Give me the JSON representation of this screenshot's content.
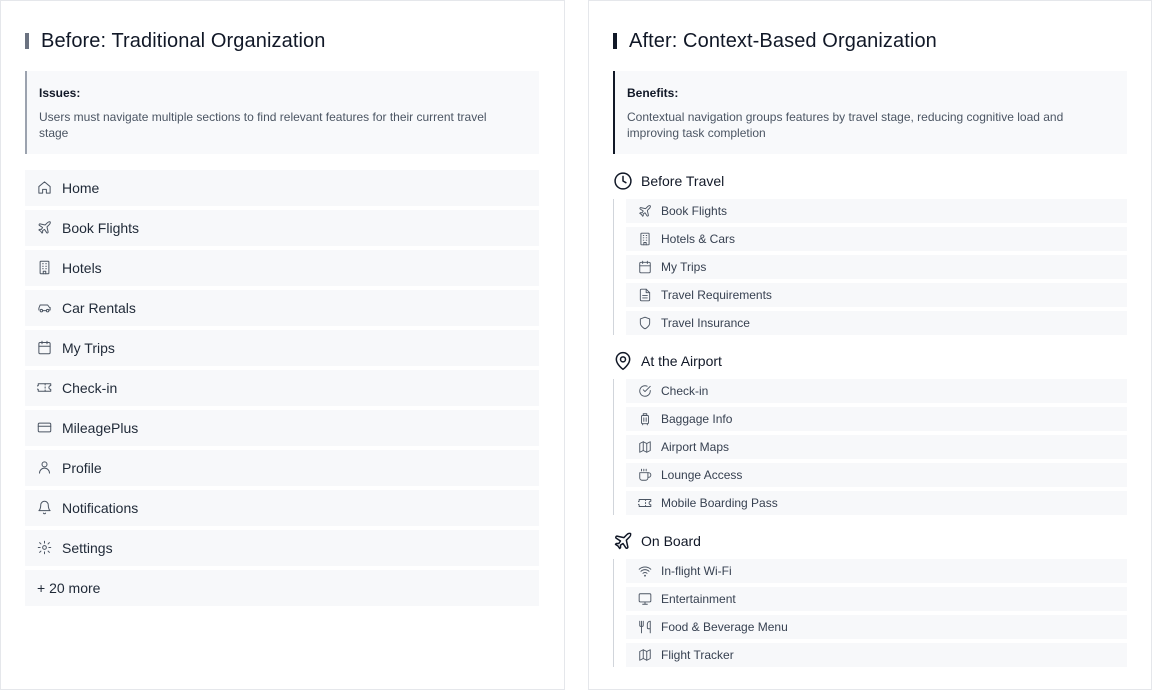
{
  "colors": {
    "accent_bar": "#6b7280",
    "accent_bar_after": "#111827"
  },
  "before": {
    "title": "Before: Traditional Organization",
    "callout": {
      "label": "Issues:",
      "text": "Users must navigate multiple sections to find relevant features for their current travel stage"
    },
    "items": [
      {
        "label": "Home",
        "icon": "home-icon"
      },
      {
        "label": "Book Flights",
        "icon": "plane-icon"
      },
      {
        "label": "Hotels",
        "icon": "building-icon"
      },
      {
        "label": "Car Rentals",
        "icon": "car-icon"
      },
      {
        "label": "My Trips",
        "icon": "calendar-icon"
      },
      {
        "label": "Check-in",
        "icon": "ticket-icon"
      },
      {
        "label": "MileagePlus",
        "icon": "credit-card-icon"
      },
      {
        "label": "Profile",
        "icon": "user-icon"
      },
      {
        "label": "Notifications",
        "icon": "bell-icon"
      },
      {
        "label": "Settings",
        "icon": "gear-icon"
      }
    ],
    "more_label": "+ 20 more"
  },
  "after": {
    "title": "After: Context-Based Organization",
    "callout": {
      "label": "Benefits:",
      "text": "Contextual navigation groups features by travel stage, reducing cognitive load and improving task completion"
    },
    "groups": [
      {
        "label": "Before Travel",
        "icon": "clock-icon",
        "items": [
          {
            "label": "Book Flights",
            "icon": "plane-icon"
          },
          {
            "label": "Hotels & Cars",
            "icon": "building-icon"
          },
          {
            "label": "My Trips",
            "icon": "calendar-icon"
          },
          {
            "label": "Travel Requirements",
            "icon": "document-icon"
          },
          {
            "label": "Travel Insurance",
            "icon": "shield-icon"
          }
        ]
      },
      {
        "label": "At the Airport",
        "icon": "map-pin-icon",
        "items": [
          {
            "label": "Check-in",
            "icon": "check-circle-icon"
          },
          {
            "label": "Baggage Info",
            "icon": "luggage-icon"
          },
          {
            "label": "Airport Maps",
            "icon": "map-icon"
          },
          {
            "label": "Lounge Access",
            "icon": "coffee-icon"
          },
          {
            "label": "Mobile Boarding Pass",
            "icon": "ticket-icon"
          }
        ]
      },
      {
        "label": "On Board",
        "icon": "plane-icon",
        "items": [
          {
            "label": "In-flight Wi-Fi",
            "icon": "wifi-icon"
          },
          {
            "label": "Entertainment",
            "icon": "monitor-icon"
          },
          {
            "label": "Food & Beverage Menu",
            "icon": "utensils-icon"
          },
          {
            "label": "Flight Tracker",
            "icon": "map-icon"
          }
        ]
      }
    ]
  }
}
